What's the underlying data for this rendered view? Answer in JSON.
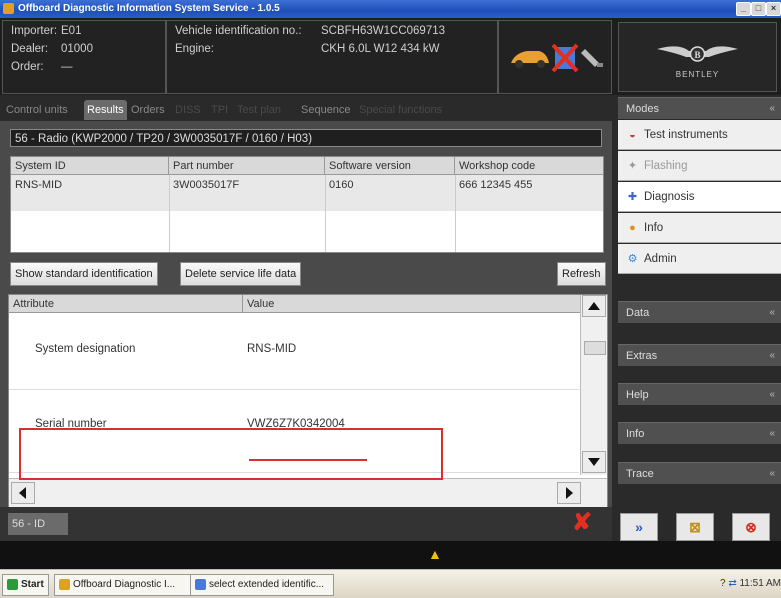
{
  "window": {
    "title": "Offboard Diagnostic Information System Service - 1.0.5",
    "controls": [
      "_",
      "□",
      "×"
    ]
  },
  "header": {
    "importer_label": "Importer:",
    "importer_value": "E01",
    "dealer_label": "Dealer:",
    "dealer_value": "01000",
    "order_label": "Order:",
    "order_value": "—",
    "vin_label": "Vehicle identification no.:",
    "vin_value": "SCBFH63W1CC069713",
    "engine_label": "Engine:",
    "engine_value": "CKH 6.0L W12 434 kW",
    "brand": "BENTLEY"
  },
  "tabs": [
    {
      "label": "Control units",
      "state": "normal"
    },
    {
      "label": "Results",
      "state": "active"
    },
    {
      "label": "Orders",
      "state": "normal"
    },
    {
      "label": "DISS",
      "state": "disabled"
    },
    {
      "label": "TPI",
      "state": "disabled"
    },
    {
      "label": "Test plan",
      "state": "disabled"
    },
    {
      "label": "Sequence",
      "state": "normal"
    },
    {
      "label": "Special functions",
      "state": "disabled"
    }
  ],
  "ecu_title": "56 - Radio  (KWP2000 / TP20 / 3W0035017F / 0160 / H03)",
  "id_table": {
    "headers": [
      "System ID",
      "Part number",
      "Software version",
      "Workshop code"
    ],
    "row": [
      "RNS-MID",
      "3W0035017F",
      "0160",
      "666 12345 455"
    ]
  },
  "buttons": {
    "show_std": "Show standard identification",
    "delete_service": "Delete service life data",
    "refresh": "Refresh"
  },
  "attr_table": {
    "headers": [
      "Attribute",
      "Value"
    ],
    "rows": [
      {
        "attribute": "System designation",
        "value": "RNS-MID"
      },
      {
        "attribute": "Serial number",
        "value": "VWZ6Z7K0342004"
      }
    ]
  },
  "status": {
    "tab_label": "56 - ID"
  },
  "modes": {
    "header": "Modes",
    "items": [
      {
        "label": "Test instruments",
        "icon": "car-gauge-icon",
        "state": "normal"
      },
      {
        "label": "Flashing",
        "icon": "flash-icon",
        "state": "disabled"
      },
      {
        "label": "Diagnosis",
        "icon": "diagnosis-icon",
        "state": "selected"
      },
      {
        "label": "Info",
        "icon": "info-icon",
        "state": "normal"
      },
      {
        "label": "Admin",
        "icon": "admin-icon",
        "state": "normal"
      }
    ]
  },
  "sections": [
    "Data",
    "Extras",
    "Help",
    "Info",
    "Trace"
  ],
  "expand_symbol": "«",
  "taskbar": {
    "start": "Start",
    "items": [
      "Offboard Diagnostic I...",
      "select extended identific..."
    ],
    "clock": "11:51 AM"
  },
  "colors": {
    "highlight": "#d83030",
    "accent_yellow": "#f2c200"
  }
}
